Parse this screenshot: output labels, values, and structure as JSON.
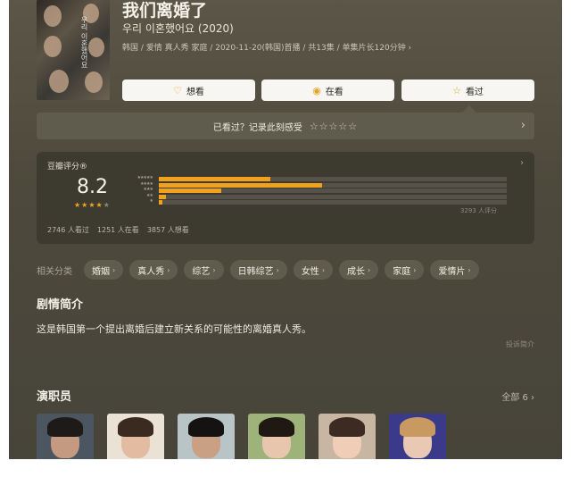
{
  "show": {
    "title": "我们离婚了",
    "original_title": "우리 이혼했어요 (2020)",
    "meta": "韩国 / 爱情 真人秀 家庭 / 2020-11-20(韩国)首播 / 共13集 / 单集片长120分钟 ›",
    "poster_text": "우리 이혼했어요"
  },
  "actions": [
    {
      "icon": "heart-icon",
      "glyph": "♡",
      "label": "想看"
    },
    {
      "icon": "eye-icon",
      "glyph": "◉",
      "label": "在看"
    },
    {
      "icon": "star-icon",
      "glyph": "☆",
      "label": "看过"
    }
  ],
  "rate_prompt": {
    "label": "已看过？记录此刻感受",
    "stars": "☆☆☆☆☆",
    "arrow": "›"
  },
  "rating": {
    "label": "豆瓣评分®",
    "arrow": "›",
    "score": "8.2",
    "stars_filled": 4,
    "stars_total": 5,
    "distribution": [
      {
        "label": "★★★★★",
        "fraction": 0.32
      },
      {
        "label": "★★★★",
        "fraction": 0.47
      },
      {
        "label": "★★★",
        "fraction": 0.18
      },
      {
        "label": "★★",
        "fraction": 0.02
      },
      {
        "label": "★",
        "fraction": 0.01
      }
    ],
    "count_text": "3293 人评分",
    "stats": [
      "2746 人看过",
      "1251 人在看",
      "3857 人想看"
    ],
    "colors": {
      "fill": "#f0a21c",
      "star": "#f0a81c"
    }
  },
  "tags": {
    "label": "相关分类",
    "items": [
      "婚姻",
      "真人秀",
      "综艺",
      "日韩综艺",
      "女性",
      "成长",
      "家庭",
      "爱情片"
    ]
  },
  "synopsis": {
    "heading": "剧情简介",
    "text": "这是韩国第一个提出离婚后建立新关系的可能性的离婚真人秀。",
    "report": "投诉简介"
  },
  "cast": {
    "heading": "演职员",
    "all_label": "全部 6 ›"
  }
}
